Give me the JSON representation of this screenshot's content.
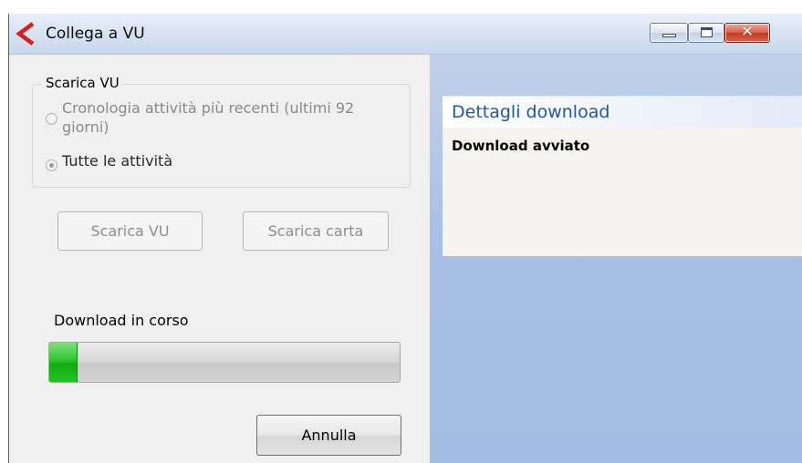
{
  "window": {
    "title": "Collega a VU",
    "close_glyph": "✕"
  },
  "download_group": {
    "legend": "Scarica VU",
    "options": [
      {
        "label": "Cronologia attività più recenti (ultimi 92 giorni)",
        "selected": false,
        "enabled": false
      },
      {
        "label": "Tutte le attività",
        "selected": true,
        "enabled": false
      }
    ]
  },
  "buttons": {
    "scarica_vu": "Scarica VU",
    "scarica_carta": "Scarica carta",
    "annulla": "Annulla"
  },
  "progress": {
    "label": "Download in corso",
    "fraction": 0.08
  },
  "details": {
    "title": "Dettagli download",
    "status": "Download avviato"
  },
  "colors": {
    "progress_fill": "#1fbb1f",
    "details_title": "#1f56a6",
    "right_panel_bg": "#a9bfe3",
    "close_button": "#c13a22"
  },
  "icons": {
    "app_logo": "red-c-logo-icon",
    "minimize": "minimize-icon",
    "maximize": "maximize-icon",
    "close": "close-icon"
  }
}
